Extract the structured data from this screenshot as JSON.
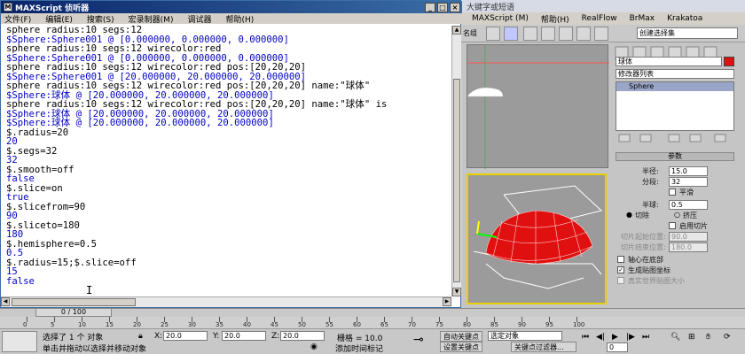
{
  "background_app": {
    "title_text": "大键字或短语",
    "menu": [
      "MAXScript (M)",
      "帮助(H)",
      "RealFlow",
      "BrMax",
      "Krakatoa"
    ],
    "toolbar_dropdown": "创建选择集",
    "left_toolbar_label": "名组"
  },
  "listener": {
    "title": "MAXScript 侦听器",
    "menu": [
      "文件(F)",
      "编辑(E)",
      "搜索(S)",
      "宏录制器(M)",
      "调试器",
      "帮助(H)"
    ],
    "lines": [
      {
        "text": "sphere radius:10 segs:12",
        "color": "black"
      },
      {
        "text": "$Sphere:Sphere001 @ [0.000000, 0.000000, 0.000000]",
        "color": "blue"
      },
      {
        "text": "sphere radius:10 segs:12 wirecolor:red",
        "color": "black"
      },
      {
        "text": "$Sphere:Sphere001 @ [0.000000, 0.000000, 0.000000]",
        "color": "blue"
      },
      {
        "text": "sphere radius:10 segs:12 wirecolor:red pos:[20,20,20]",
        "color": "black"
      },
      {
        "text": "$Sphere:Sphere001 @ [20.000000, 20.000000, 20.000000]",
        "color": "blue"
      },
      {
        "text": "sphere radius:10 segs:12 wirecolor:red pos:[20,20,20] name:\"球体\"",
        "color": "black"
      },
      {
        "text": "$Sphere:球体 @ [20.000000, 20.000000, 20.000000]",
        "color": "blue"
      },
      {
        "text": "sphere radius:10 segs:12 wirecolor:red pos:[20,20,20] name:\"球体\" is",
        "color": "black"
      },
      {
        "text": "$Sphere:球体 @ [20.000000, 20.000000, 20.000000]",
        "color": "blue"
      },
      {
        "text": "$Sphere:球体 @ [20.000000, 20.000000, 20.000000]",
        "color": "blue"
      },
      {
        "text": "$.radius=20",
        "color": "black"
      },
      {
        "text": "20",
        "color": "blue"
      },
      {
        "text": "$.segs=32",
        "color": "black"
      },
      {
        "text": "32",
        "color": "blue"
      },
      {
        "text": "$.smooth=off",
        "color": "black"
      },
      {
        "text": "false",
        "color": "blue"
      },
      {
        "text": "$.slice=on",
        "color": "black"
      },
      {
        "text": "true",
        "color": "blue"
      },
      {
        "text": "$.slicefrom=90",
        "color": "black"
      },
      {
        "text": "90",
        "color": "blue"
      },
      {
        "text": "$.sliceto=180",
        "color": "black"
      },
      {
        "text": "180",
        "color": "blue"
      },
      {
        "text": "$.hemisphere=0.5",
        "color": "black"
      },
      {
        "text": "0.5",
        "color": "blue"
      },
      {
        "text": "$.radius=15;$.slice=off",
        "color": "black"
      },
      {
        "text": "15",
        "color": "blue"
      },
      {
        "text": "false",
        "color": "blue"
      },
      {
        "text": "",
        "color": "black"
      }
    ]
  },
  "command_panel": {
    "object_name": "球体",
    "modifier_list": "修改器列表",
    "stack_item": "Sphere",
    "rollout_title": "参数",
    "radius_label": "半径:",
    "radius_value": "15.0",
    "segments_label": "分段:",
    "segments_value": "32",
    "smooth_label": "平滑",
    "hemisphere_label": "半球:",
    "hemisphere_value": "0.5",
    "chop_label": "切除",
    "squash_label": "挤压",
    "enable_slice_label": "启用切片",
    "slice_from_label": "切片起始位置:",
    "slice_from_value": "90.0",
    "slice_to_label": "切片结束位置:",
    "slice_to_value": "180.0",
    "base_to_pivot_label": "轴心在底部",
    "gen_mapping_label": "生成贴图坐标",
    "real_world_label": "真实世界贴图大小"
  },
  "status": {
    "frame": "0 / 100",
    "ruler_ticks": [
      "0",
      "5",
      "10",
      "15",
      "20",
      "25",
      "30",
      "35",
      "40",
      "45",
      "50",
      "55",
      "60",
      "65",
      "70",
      "75",
      "80",
      "85",
      "90",
      "95",
      "100"
    ],
    "selected": "选择了 1 个 对象",
    "prompt": "单击并拖动以选择并移动对象",
    "x_label": "X:",
    "x_value": "20.0",
    "y_label": "Y:",
    "y_value": "20.0",
    "z_label": "Z:",
    "z_value": "20.0",
    "grid": "栅格 = 10.0",
    "auto_key": "自动关键点",
    "selected_obj": "选定对象",
    "set_key": "设置关键点",
    "key_filters": "关键点过滤器...",
    "add_time_tag": "添加时间标记",
    "frame_value": "0"
  },
  "colors": {
    "output_blue": "#0000c0",
    "title_gradient_start": "#0a246a",
    "sphere_red": "#e01010",
    "viewport_active": "#e8d000"
  }
}
